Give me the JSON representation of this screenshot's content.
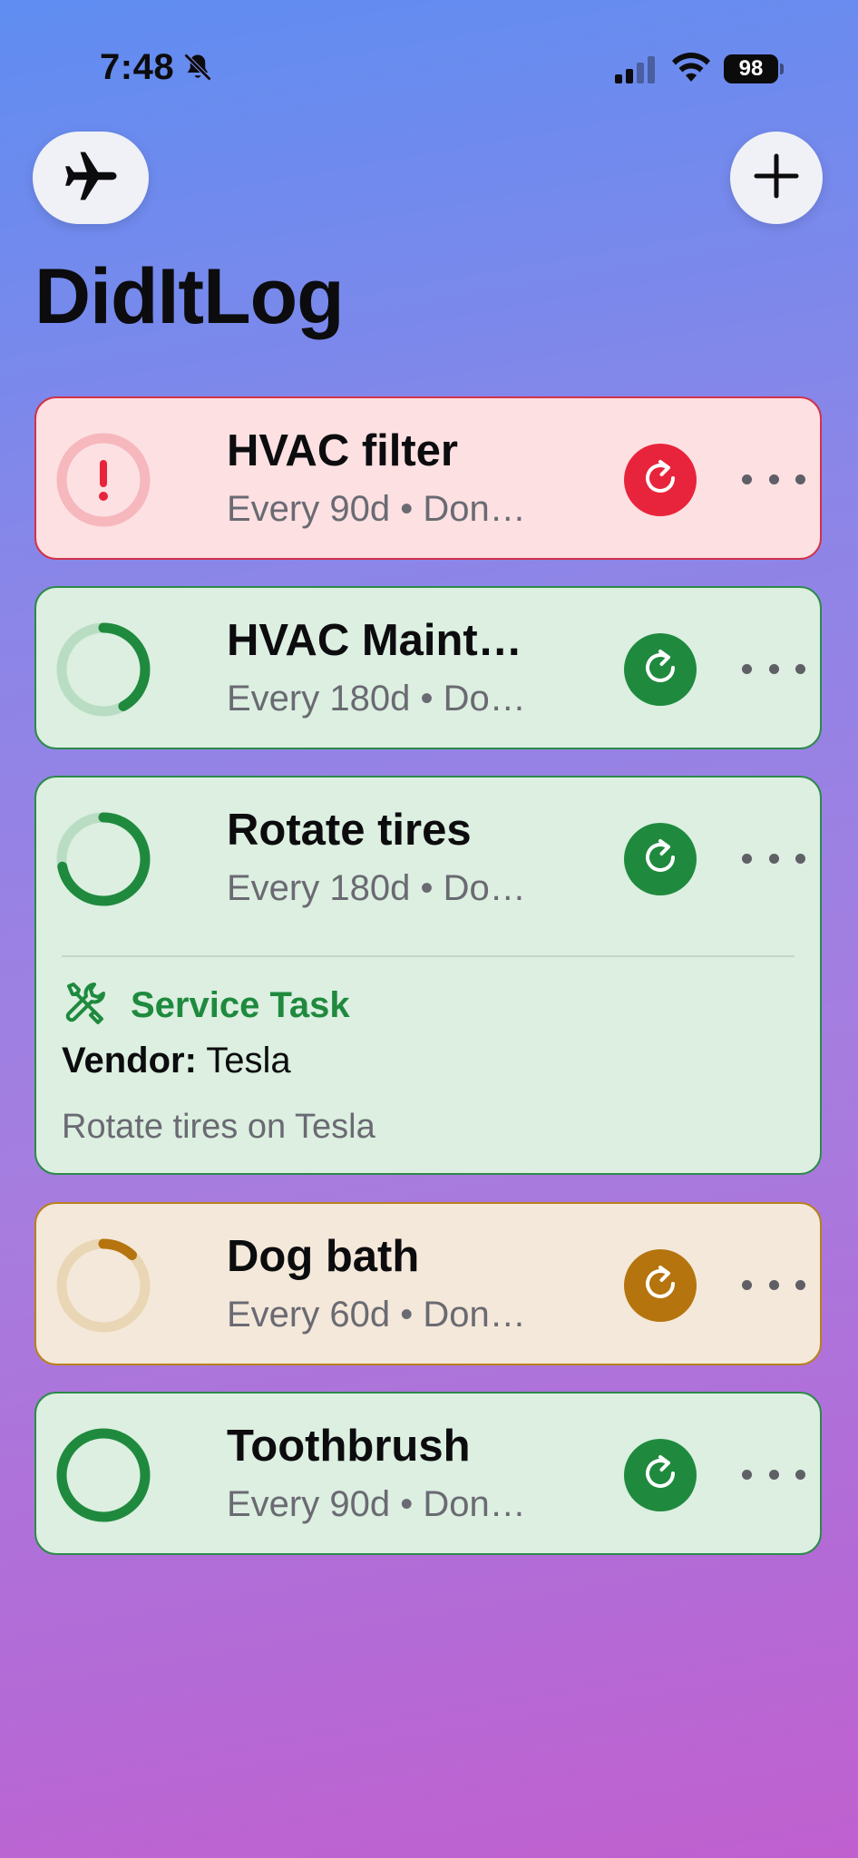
{
  "status_bar": {
    "time": "7:48",
    "battery": "98"
  },
  "header": {
    "title": "DidItLog"
  },
  "tasks": [
    {
      "name": "HVAC filter",
      "subtitle": "Every 90d • Don…",
      "state": "overdue",
      "status_icon": "exclamation-icon",
      "progress": 0,
      "accent": "#e8243c"
    },
    {
      "name": "HVAC Maint…",
      "subtitle": "Every 180d • Do…",
      "state": "ok",
      "progress": 0.42,
      "accent": "#1f8a3e"
    },
    {
      "name": "Rotate tires",
      "subtitle": "Every 180d • Do…",
      "state": "ok",
      "progress": 0.72,
      "accent": "#1f8a3e",
      "details": {
        "type_label": "Service Task",
        "vendor_label": "Vendor:",
        "vendor_value": "Tesla",
        "notes": "Rotate tires on Tesla"
      }
    },
    {
      "name": "Dog bath",
      "subtitle": "Every 60d • Don…",
      "state": "warn",
      "progress": 0.12,
      "accent": "#b5740e"
    },
    {
      "name": "Toothbrush",
      "subtitle": "Every 90d • Don…",
      "state": "ok",
      "progress": 1.0,
      "accent": "#1f8a3e"
    }
  ],
  "colors": {
    "ok": "#1f8a3e",
    "overdue": "#e8243c",
    "warn": "#b5740e"
  }
}
